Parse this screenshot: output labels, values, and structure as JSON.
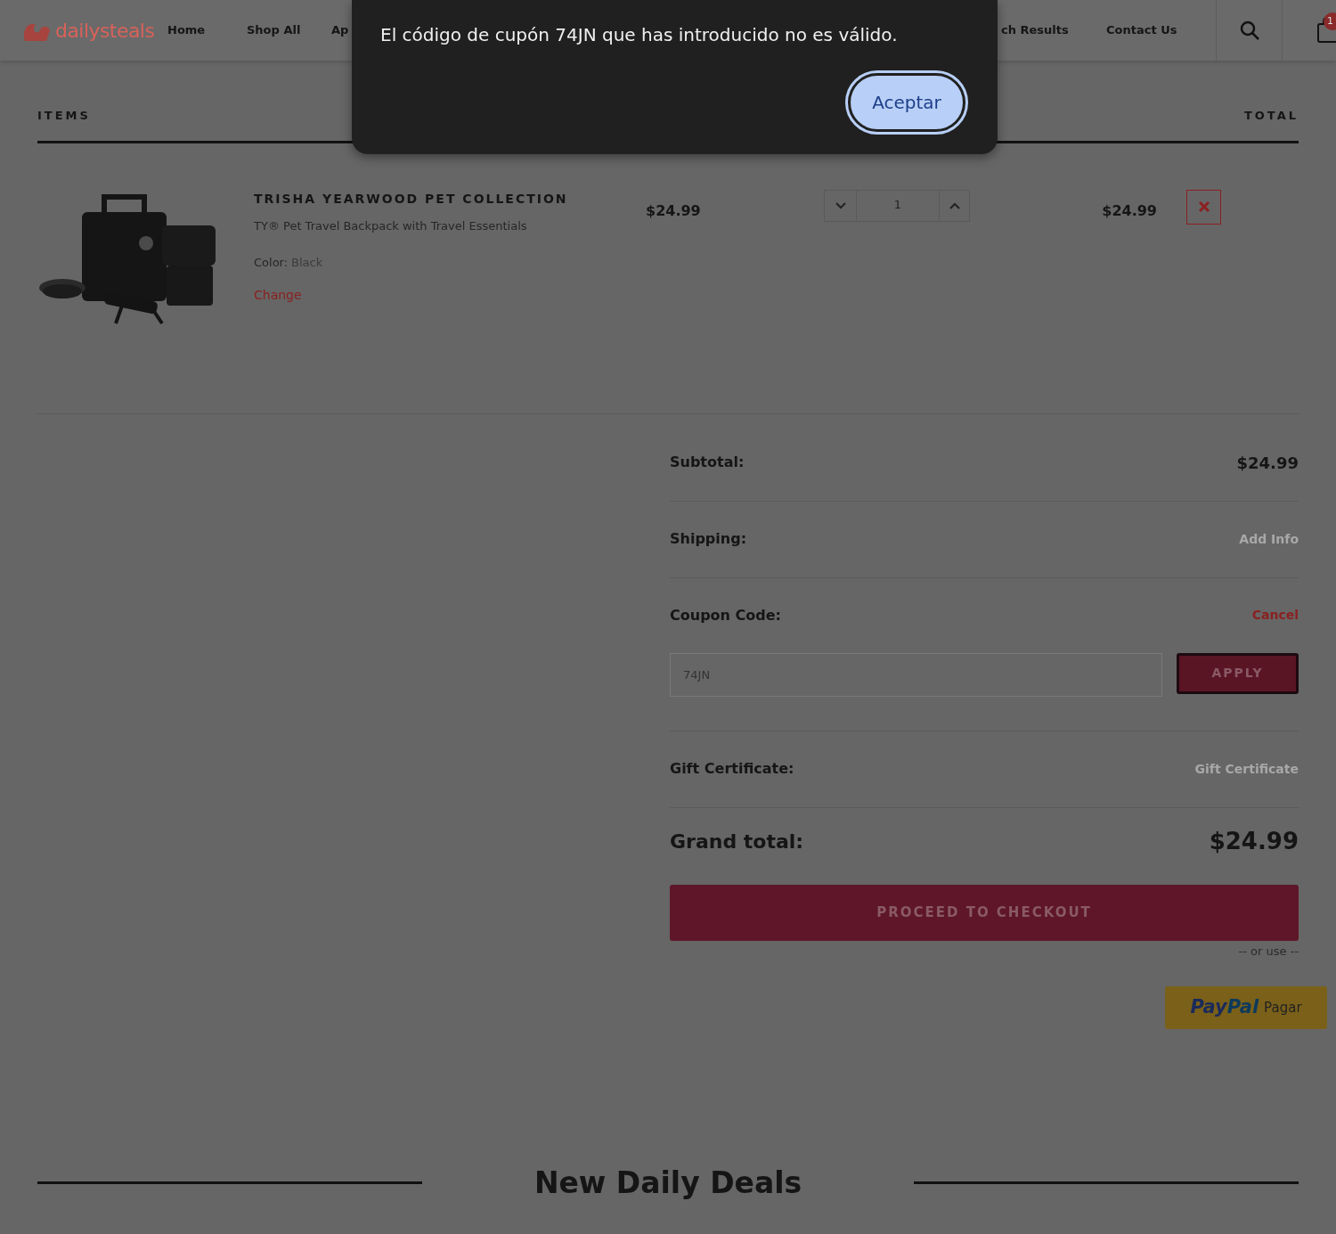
{
  "header": {
    "logo": "dailysteals",
    "nav": [
      {
        "label": "Home"
      },
      {
        "label": "Shop All"
      },
      {
        "label": "Ap"
      },
      {
        "label": "ch Results"
      },
      {
        "label": "Contact Us"
      }
    ],
    "cart_count": "1"
  },
  "dialog": {
    "message": "El código de cupón 74JN que has introducido no es válido.",
    "button": "Aceptar"
  },
  "table": {
    "columns": [
      "ITEMS",
      "TOTAL"
    ],
    "rows": [
      {
        "brand": "TRISHA YEARWOOD PET COLLECTION",
        "name": "TY® Pet Travel Backpack with Travel Essentials",
        "option_label": "Color:",
        "option_value": "Black",
        "change": "Change",
        "price": "$24.99",
        "quantity": "1",
        "total": "$24.99"
      }
    ]
  },
  "summary": {
    "subtotal_label": "Subtotal:",
    "subtotal": "$24.99",
    "shipping_label": "Shipping:",
    "shipping_action": "Add Info",
    "coupon_label": "Coupon Code:",
    "coupon_action": "Cancel",
    "coupon_value": "74JN",
    "apply": "APPLY",
    "gift_label": "Gift Certificate:",
    "gift_action": "Gift Certificate",
    "grand_label": "Grand total:",
    "grand_total": "$24.99",
    "checkout": "PROCEED TO CHECKOUT",
    "or_use": "-- or use --",
    "paypal": {
      "brand_a": "Pay",
      "brand_b": "Pal",
      "label": "Pagar"
    }
  },
  "section_title": "New Daily Deals"
}
